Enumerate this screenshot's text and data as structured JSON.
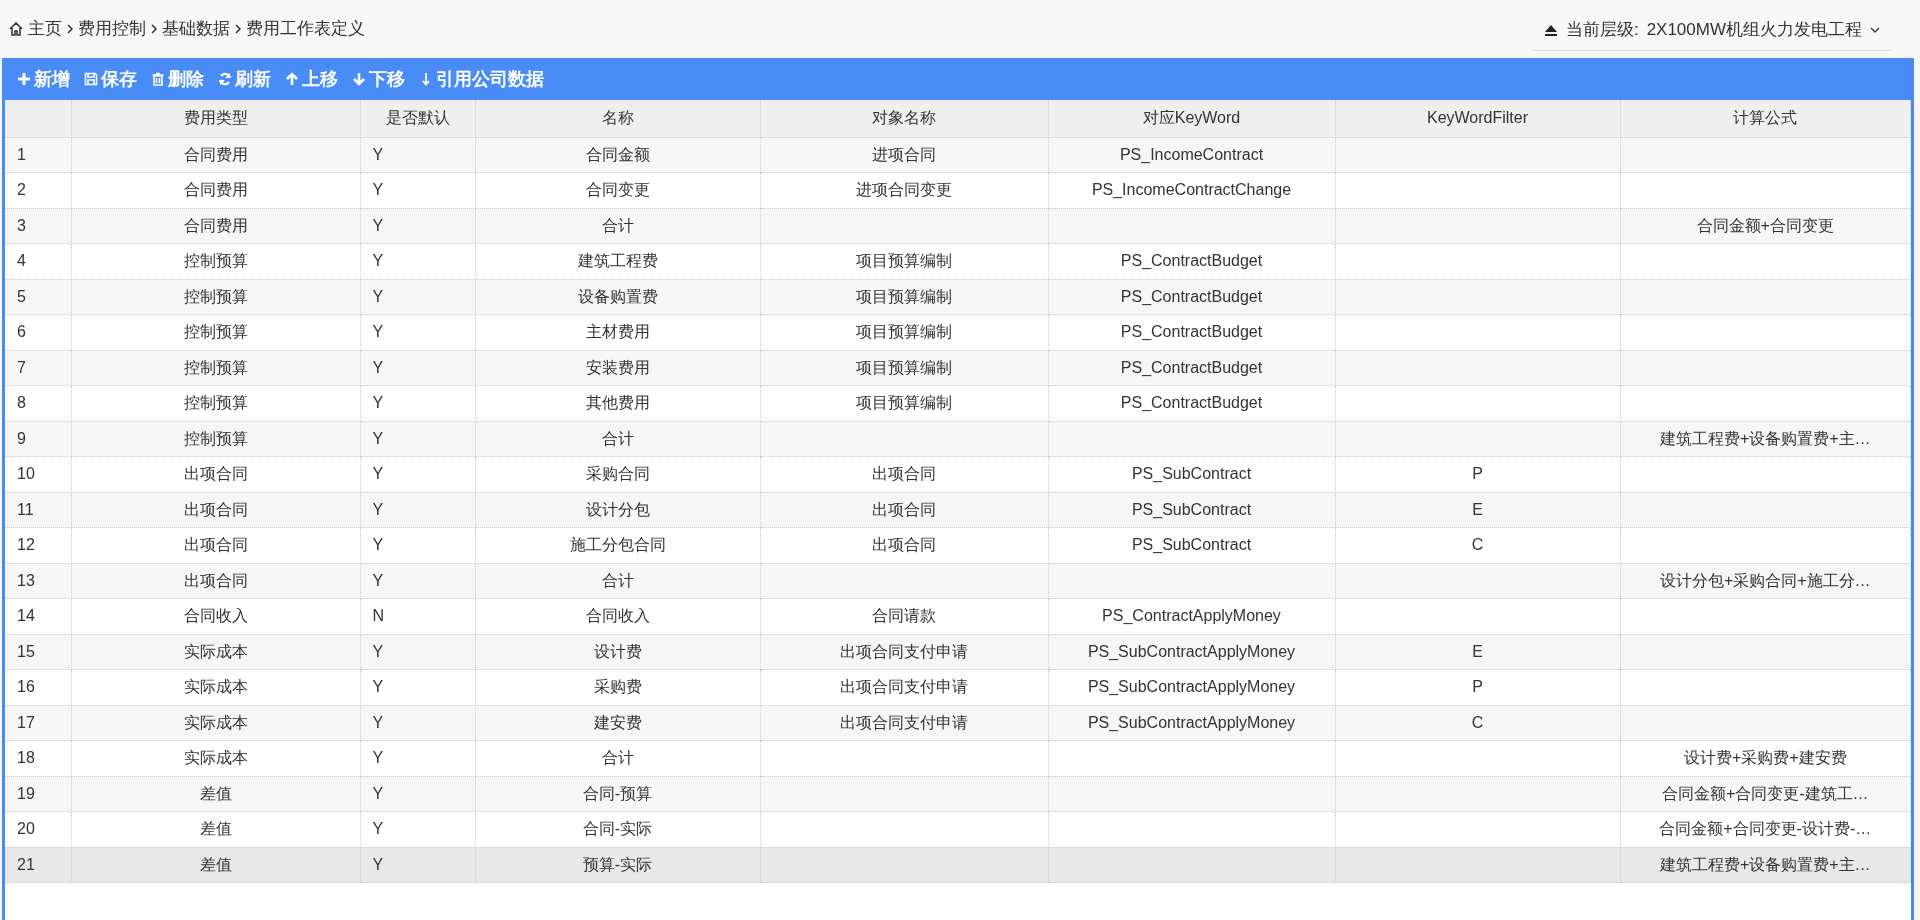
{
  "breadcrumb": [
    "主页",
    "费用控制",
    "基础数据",
    "费用工作表定义"
  ],
  "level_selector": {
    "label": "当前层级:",
    "value": "2X100MW机组火力发电工程"
  },
  "toolbar": [
    {
      "kind": "add",
      "label": "新增"
    },
    {
      "kind": "save",
      "label": "保存"
    },
    {
      "kind": "delete",
      "label": "删除"
    },
    {
      "kind": "refresh",
      "label": "刷新"
    },
    {
      "kind": "up",
      "label": "上移"
    },
    {
      "kind": "down",
      "label": "下移"
    },
    {
      "kind": "import",
      "label": "引用公司数据"
    }
  ],
  "table": {
    "columns": [
      "费用类型",
      "是否默认",
      "名称",
      "对象名称",
      "对应KeyWord",
      "KeyWordFilter",
      "计算公式"
    ],
    "rows": [
      {
        "index": "1",
        "selected": false,
        "cells": [
          "合同费用",
          "Y",
          "合同金额",
          "进项合同",
          "PS_IncomeContract",
          "",
          ""
        ]
      },
      {
        "index": "2",
        "selected": false,
        "cells": [
          "合同费用",
          "Y",
          "合同变更",
          "进项合同变更",
          "PS_IncomeContractChange",
          "",
          ""
        ]
      },
      {
        "index": "3",
        "selected": false,
        "cells": [
          "合同费用",
          "Y",
          "合计",
          "",
          "",
          "",
          "合同金额+合同变更"
        ]
      },
      {
        "index": "4",
        "selected": false,
        "cells": [
          "控制预算",
          "Y",
          "建筑工程费",
          "项目预算编制",
          "PS_ContractBudget",
          "",
          ""
        ]
      },
      {
        "index": "5",
        "selected": false,
        "cells": [
          "控制预算",
          "Y",
          "设备购置费",
          "项目预算编制",
          "PS_ContractBudget",
          "",
          ""
        ]
      },
      {
        "index": "6",
        "selected": false,
        "cells": [
          "控制预算",
          "Y",
          "主材费用",
          "项目预算编制",
          "PS_ContractBudget",
          "",
          ""
        ]
      },
      {
        "index": "7",
        "selected": false,
        "cells": [
          "控制预算",
          "Y",
          "安装费用",
          "项目预算编制",
          "PS_ContractBudget",
          "",
          ""
        ]
      },
      {
        "index": "8",
        "selected": false,
        "cells": [
          "控制预算",
          "Y",
          "其他费用",
          "项目预算编制",
          "PS_ContractBudget",
          "",
          ""
        ]
      },
      {
        "index": "9",
        "selected": false,
        "cells": [
          "控制预算",
          "Y",
          "合计",
          "",
          "",
          "",
          "建筑工程费+设备购置费+主…"
        ]
      },
      {
        "index": "10",
        "selected": false,
        "cells": [
          "出项合同",
          "Y",
          "采购合同",
          "出项合同",
          "PS_SubContract",
          "P",
          ""
        ]
      },
      {
        "index": "11",
        "selected": false,
        "cells": [
          "出项合同",
          "Y",
          "设计分包",
          "出项合同",
          "PS_SubContract",
          "E",
          ""
        ]
      },
      {
        "index": "12",
        "selected": false,
        "cells": [
          "出项合同",
          "Y",
          "施工分包合同",
          "出项合同",
          "PS_SubContract",
          "C",
          ""
        ]
      },
      {
        "index": "13",
        "selected": false,
        "cells": [
          "出项合同",
          "Y",
          "合计",
          "",
          "",
          "",
          "设计分包+采购合同+施工分…"
        ]
      },
      {
        "index": "14",
        "selected": false,
        "cells": [
          "合同收入",
          "N",
          "合同收入",
          "合同请款",
          "PS_ContractApplyMoney",
          "",
          ""
        ]
      },
      {
        "index": "15",
        "selected": false,
        "cells": [
          "实际成本",
          "Y",
          "设计费",
          "出项合同支付申请",
          "PS_SubContractApplyMoney",
          "E",
          ""
        ]
      },
      {
        "index": "16",
        "selected": false,
        "cells": [
          "实际成本",
          "Y",
          "采购费",
          "出项合同支付申请",
          "PS_SubContractApplyMoney",
          "P",
          ""
        ]
      },
      {
        "index": "17",
        "selected": false,
        "cells": [
          "实际成本",
          "Y",
          "建安费",
          "出项合同支付申请",
          "PS_SubContractApplyMoney",
          "C",
          ""
        ]
      },
      {
        "index": "18",
        "selected": false,
        "cells": [
          "实际成本",
          "Y",
          "合计",
          "",
          "",
          "",
          "设计费+采购费+建安费"
        ]
      },
      {
        "index": "19",
        "selected": false,
        "cells": [
          "差值",
          "Y",
          "合同-预算",
          "",
          "",
          "",
          "合同金额+合同变更-建筑工…"
        ]
      },
      {
        "index": "20",
        "selected": false,
        "cells": [
          "差值",
          "Y",
          "合同-实际",
          "",
          "",
          "",
          "合同金额+合同变更-设计费-…"
        ]
      },
      {
        "index": "21",
        "selected": true,
        "cells": [
          "差值",
          "Y",
          "预算-实际",
          "",
          "",
          "",
          "建筑工程费+设备购置费+主…"
        ]
      }
    ]
  }
}
